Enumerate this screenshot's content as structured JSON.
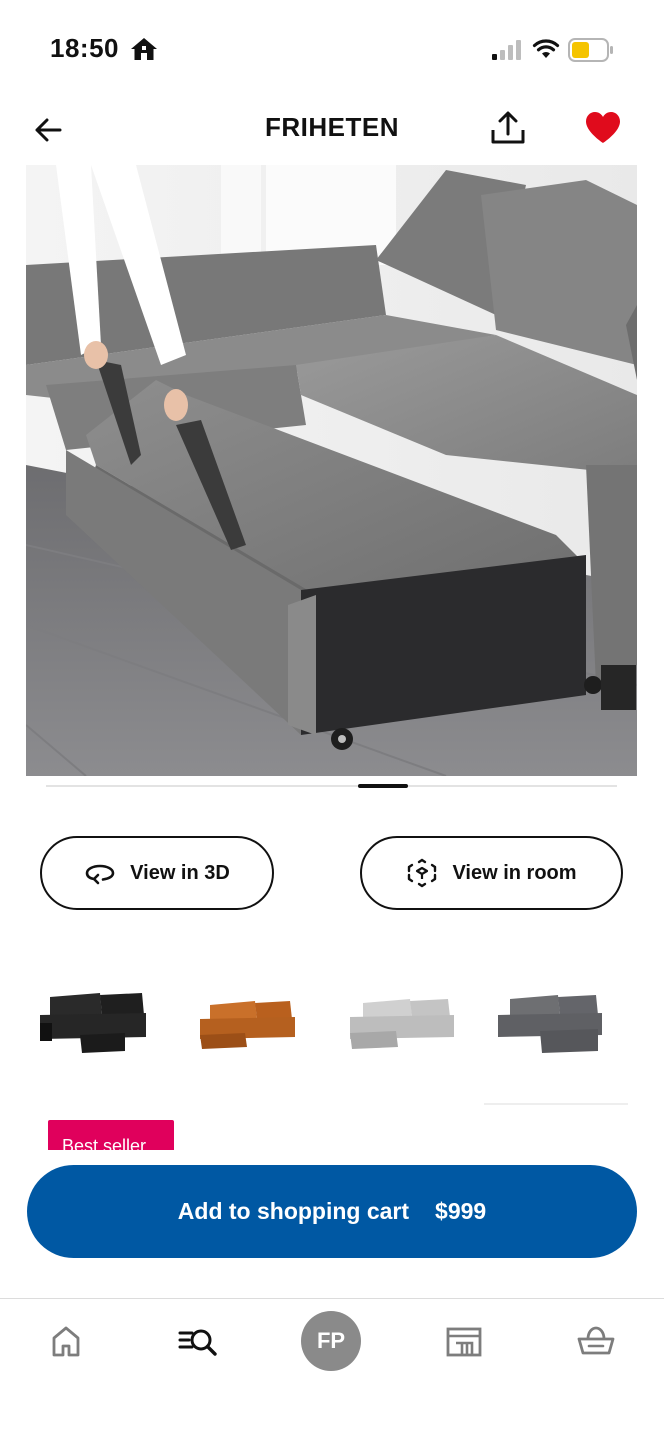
{
  "status_bar": {
    "time": "18:50"
  },
  "header": {
    "title": "FRIHETEN"
  },
  "actions": {
    "view_3d_label": "View in 3D",
    "view_room_label": "View in room"
  },
  "variants": [
    {
      "name": "black-sofa",
      "color": "#2a2a2a"
    },
    {
      "name": "orange-sofa",
      "color": "#c9702a"
    },
    {
      "name": "light-gray-sofa",
      "color": "#c8c8c8"
    },
    {
      "name": "dark-gray-sofa",
      "color": "#6e6f72"
    }
  ],
  "badge": {
    "label": "Best seller"
  },
  "cart": {
    "label": "Add to shopping cart",
    "price": "$999"
  },
  "nav": {
    "avatar_initials": "FP"
  },
  "colors": {
    "accent_blue": "#0058a3",
    "badge_pink": "#e0005c",
    "heart_red": "#e00b1c"
  }
}
